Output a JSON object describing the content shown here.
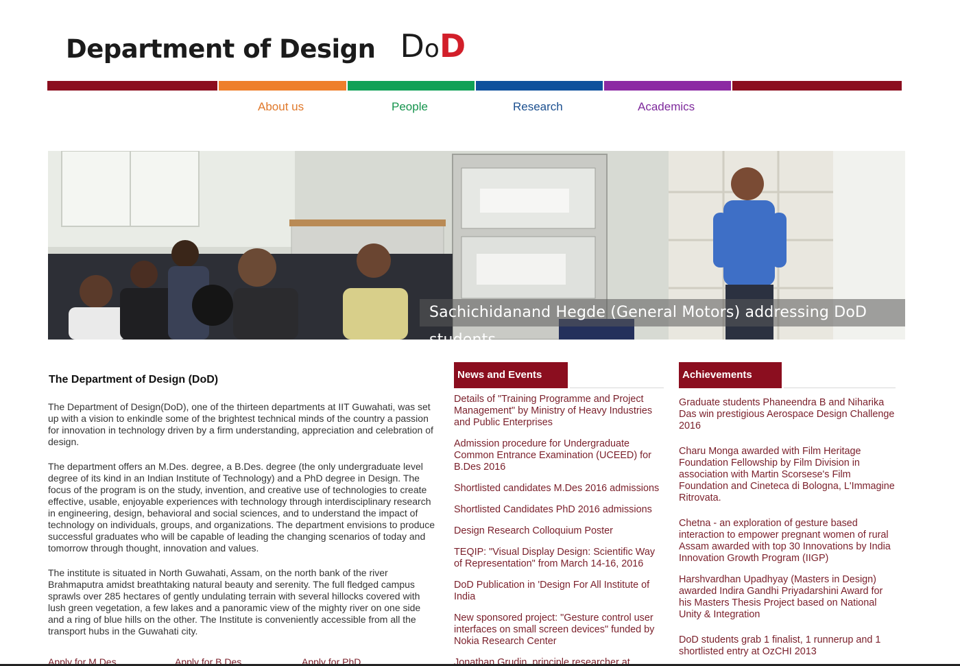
{
  "header": {
    "title": "Department of Design",
    "logo_mark": {
      "d1": "D",
      "o": "o",
      "d2": "D"
    }
  },
  "colors": {
    "bars": [
      "#8b0e1f",
      "#ee7f2b",
      "#10a156",
      "#0f519c",
      "#8c2aa3",
      "#8b0e1f"
    ],
    "accent": "#8b0e1f",
    "link": "#7a1f2a"
  },
  "nav": [
    {
      "label": "About us",
      "color": "#e0782a"
    },
    {
      "label": "People",
      "color": "#15944d"
    },
    {
      "label": "Research",
      "color": "#1b4f8f"
    },
    {
      "label": "Academics",
      "color": "#7e2a9c"
    }
  ],
  "hero": {
    "caption": "Sachichidanand Hegde (General Motors) addressing DoD students"
  },
  "intro": {
    "heading": "The Department of Design (DoD)",
    "paragraphs": [
      "The Department of Design(DoD), one of the thirteen departments at IIT Guwahati, was set up with a vision to enkindle some of the brightest technical minds of the country a passion for innovation in technology driven by a firm understanding, appreciation and celebration of design.",
      "The department offers an M.Des. degree, a B.Des. degree (the only undergraduate level degree of its kind in an Indian Institute of Technology) and a PhD degree in Design. The focus of the program is on the study, invention, and creative use of technologies to create effective, usable, enjoyable experiences with technology through interdisciplinary research in engineering, design, behavioral and social sciences, and to understand the impact of technology on individuals, groups, and organizations. The department envisions to produce successful graduates who will be capable of leading the changing scenarios of today and tomorrow through thought, innovation and values.",
      "The institute is situated in North Guwahati, Assam, on the north bank of the river Brahmaputra amidst breathtaking natural beauty and serenity. The full fledged campus sprawls over 285 hectares of gently undulating terrain with several hillocks covered with lush green vegetation, a few lakes and a panoramic view of the mighty river on one side and a ring of blue hills on the other. The Institute is conveniently accessible from all the transport hubs in the Guwahati city."
    ],
    "apply_links": [
      "Apply for M.Des",
      "Apply for B.Des",
      "Apply for PhD"
    ]
  },
  "news": {
    "title": "News and Events",
    "items": [
      "Details of \"Training Programme and Project Management\" by Ministry of Heavy Industries and Public Enterprises",
      "Admission procedure for Undergraduate Common Entrance Examination (UCEED) for B.Des 2016",
      "Shortlisted candidates M.Des 2016 admissions",
      "Shortlisted Candidates PhD 2016 admissions",
      "Design Research Colloquium Poster",
      "TEQIP: \"Visual Display Design: Scientific Way of Representation\" from March 14-16, 2016",
      "DoD Publication in 'Design For All Institute of India",
      "New sponsored project: \"Gesture control user interfaces on small screen devices\" funded by Nokia Research Center",
      "Jonathan Grudin, principle researcher at"
    ]
  },
  "achievements": {
    "title": "Achievements",
    "items": [
      "Graduate students Phaneendra B and Niharika Das win prestigious Aerospace Design Challenge 2016",
      "Charu Monga awarded with Film Heritage Foundation Fellowship by Film Division in association with Martin Scorsese's Film Foundation and Cineteca di Bologna, L'Immagine Ritrovata.",
      "Chetna - an exploration of gesture based interaction to empower pregnant women of rural Assam awarded with top 30 Innovations by India Innovation Growth Program (IIGP)",
      "Harshvardhan Upadhyay (Masters in Design) awarded Indira Gandhi Priyadarshini Award for his Masters Thesis Project based on National Unity & Integration",
      "DoD students grab 1 finalist, 1 runnerup and 1 shortlisted entry at OzCHI 2013"
    ]
  }
}
